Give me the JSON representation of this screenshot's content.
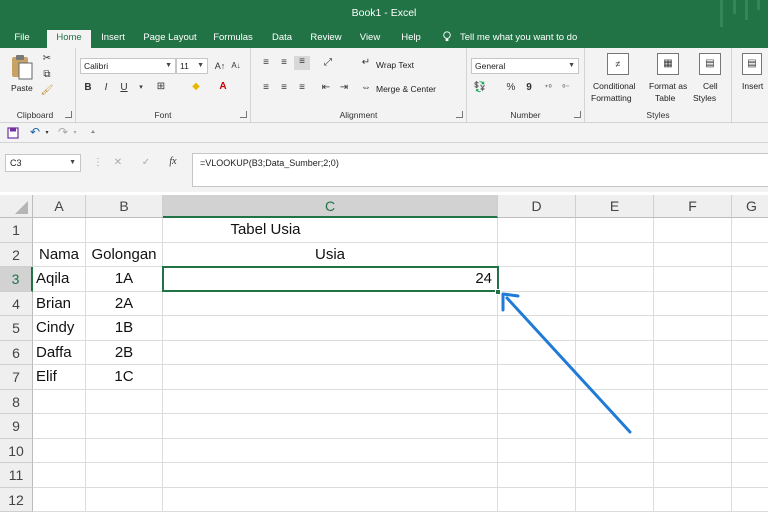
{
  "window": {
    "title": "Book1  -  Excel"
  },
  "tabs": [
    "File",
    "Home",
    "Insert",
    "Page Layout",
    "Formulas",
    "Data",
    "Review",
    "View",
    "Help"
  ],
  "tell_me": "Tell me what you want to do",
  "ribbon": {
    "clipboard": {
      "paste": "Paste",
      "label": "Clipboard"
    },
    "font": {
      "name": "Calibri",
      "size": "11",
      "bold": "B",
      "italic": "I",
      "underline": "U",
      "label": "Font"
    },
    "alignment": {
      "wrap_text": "Wrap Text",
      "merge_center": "Merge & Center",
      "label": "Alignment"
    },
    "number": {
      "format": "General",
      "percent": "%",
      "comma": "9",
      "label": "Number"
    },
    "styles": {
      "conditional_1": "Conditional",
      "conditional_2": "Formatting",
      "format_as_1": "Format as",
      "format_as_2": "Table",
      "cell_styles_1": "Cell",
      "cell_styles_2": "Styles",
      "label": "Styles"
    },
    "cells": {
      "insert": "Insert"
    }
  },
  "formula_bar": {
    "name_box": "C3",
    "fx": "fx",
    "formula": "=VLOOKUP(B3;Data_Sumber;2;0)"
  },
  "sheet": {
    "columns": [
      "A",
      "B",
      "C",
      "D",
      "E",
      "F",
      "G"
    ],
    "rows": [
      "1",
      "2",
      "3",
      "4",
      "5",
      "6",
      "7",
      "8",
      "9",
      "10",
      "11",
      "12"
    ],
    "title": "Tabel Usia",
    "headers": {
      "nama": "Nama",
      "golongan": "Golongan",
      "usia": "Usia"
    },
    "data": [
      {
        "nama": "Aqila",
        "golongan": "1A",
        "usia": "24"
      },
      {
        "nama": "Brian",
        "golongan": "2A",
        "usia": ""
      },
      {
        "nama": "Cindy",
        "golongan": "1B",
        "usia": ""
      },
      {
        "nama": "Daffa",
        "golongan": "2B",
        "usia": ""
      },
      {
        "nama": "Elif",
        "golongan": "1C",
        "usia": ""
      }
    ],
    "active_cell": "C3"
  },
  "colors": {
    "excel_green": "#217346",
    "arrow_blue": "#1f7bd6"
  }
}
